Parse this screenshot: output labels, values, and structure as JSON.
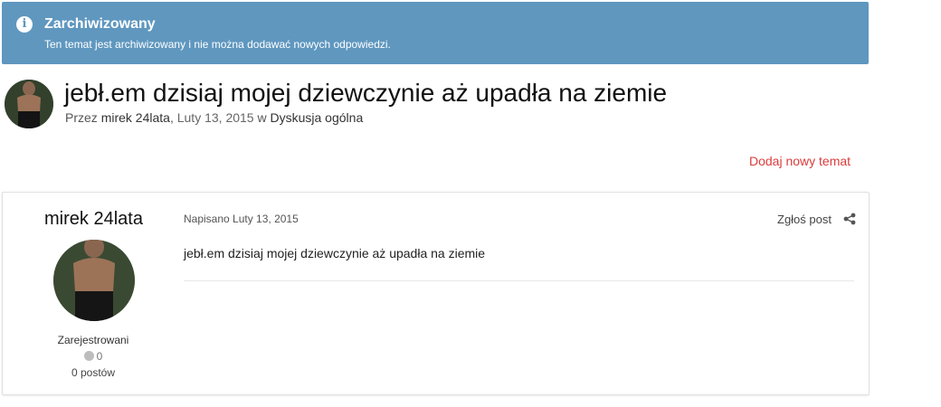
{
  "banner": {
    "icon": "info-icon",
    "title": "Zarchiwizowany",
    "text": "Ten temat jest archiwizowany i nie można dodawać nowych odpowiedzi.",
    "color": "#5f97bf"
  },
  "topic": {
    "title": "jebł.em dzisiaj mojej dziewczynie aż upadła na ziemie",
    "by_prefix": "Przez",
    "author": "mirek 24lata",
    "date": "Luty 13, 2015",
    "in_word": "w",
    "forum": "Dyskusja ogólna"
  },
  "actions": {
    "new_topic": "Dodaj nowy temat",
    "accent": "#dc3c3c"
  },
  "post": {
    "author": "mirek 24lata",
    "group": "Zarejestrowani",
    "reputation": "0",
    "posts_count": "0 postów",
    "meta": "Napisano Luty 13, 2015",
    "report": "Zgłoś post",
    "share_icon": "share-icon",
    "body": "jebł.em dzisiaj mojej dziewczynie aż upadła na ziemie"
  }
}
